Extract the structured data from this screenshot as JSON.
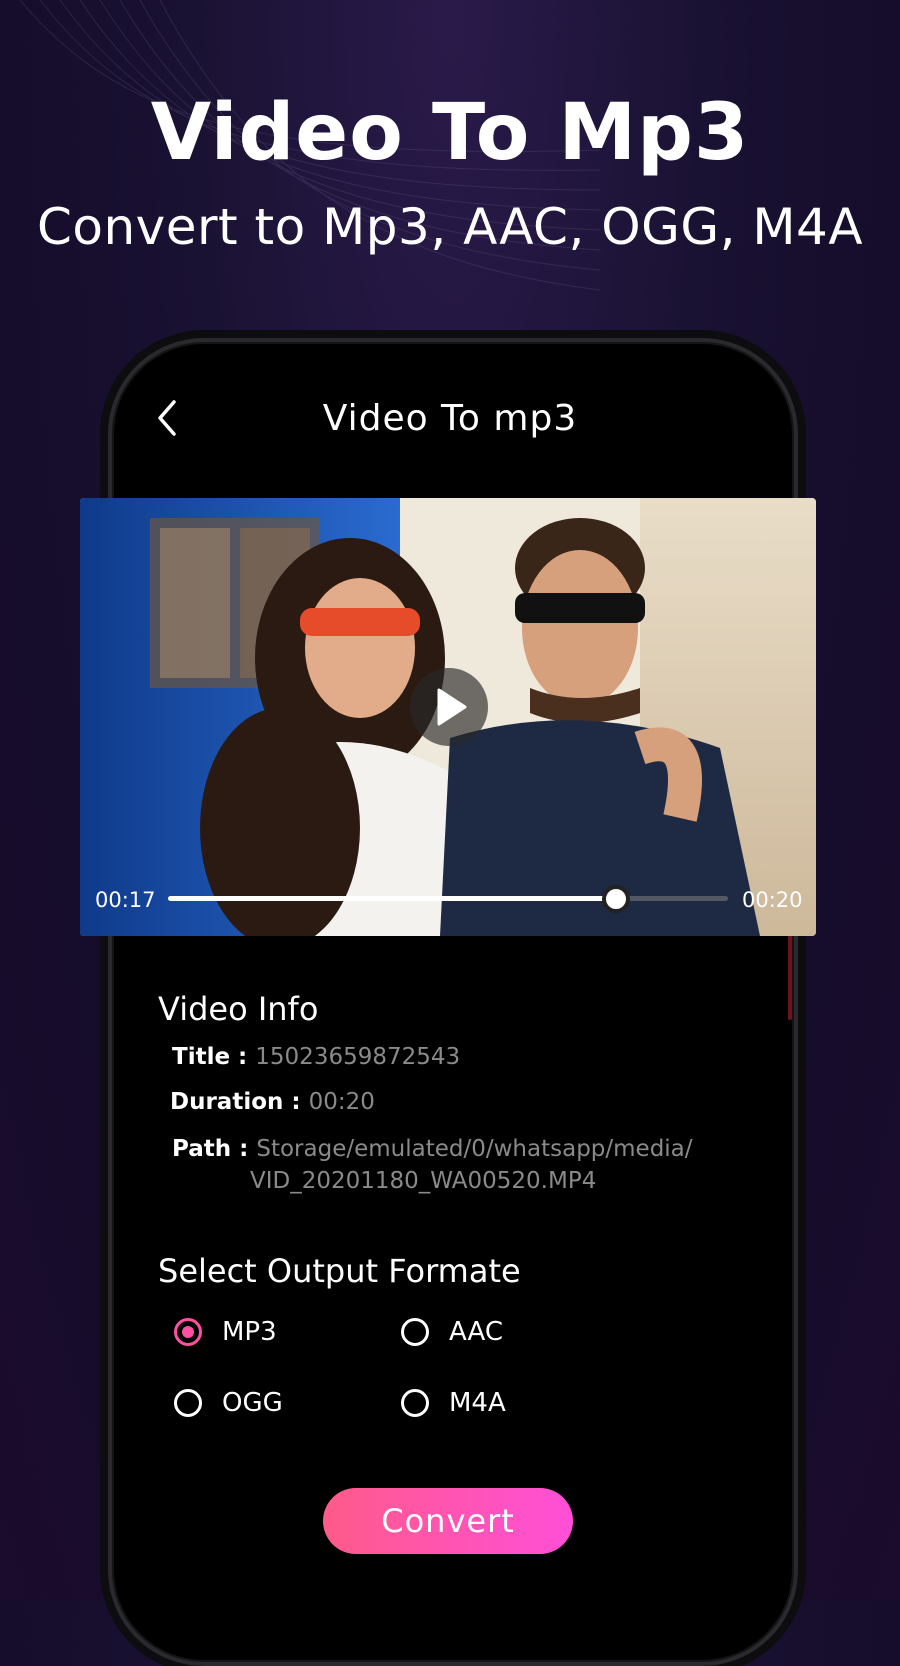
{
  "promo": {
    "headline": "Video To Mp3",
    "subline": "Convert to Mp3, AAC, OGG, M4A"
  },
  "header": {
    "back_icon": "chevron-left-icon",
    "title": "Video To mp3"
  },
  "player": {
    "current_time": "00:17",
    "total_time": "00:20",
    "progress_fraction": 0.8,
    "play_icon": "play-icon"
  },
  "video_info": {
    "heading": "Video Info",
    "title_label": "Title :",
    "title_value": "15023659872543",
    "duration_label": "Duration :",
    "duration_value": "00:20",
    "path_label": "Path :",
    "path_value_line1": "Storage/emulated/0/whatsapp/media/",
    "path_value_line2": "VID_20201180_WA00520.MP4"
  },
  "output": {
    "heading": "Select Output Formate",
    "options": [
      {
        "label": "MP3",
        "selected": true
      },
      {
        "label": "AAC",
        "selected": false
      },
      {
        "label": "OGG",
        "selected": false
      },
      {
        "label": "M4A",
        "selected": false
      }
    ]
  },
  "convert_label": "Convert",
  "colors": {
    "accent": "#ff4fa0",
    "button_gradient_start": "#ff5a8a",
    "button_gradient_end": "#ff4fd8",
    "muted_text": "#8a8a8a"
  }
}
